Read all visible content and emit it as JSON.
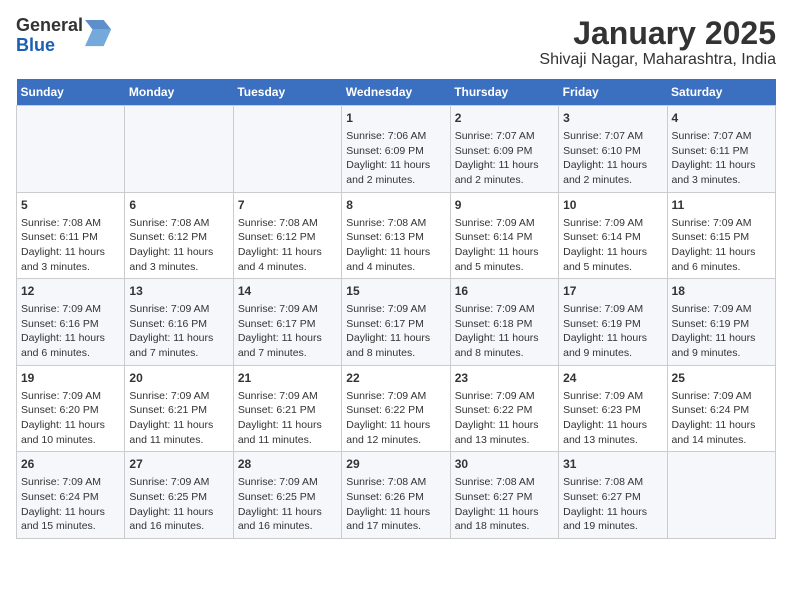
{
  "header": {
    "logo_line1": "General",
    "logo_line2": "Blue",
    "title": "January 2025",
    "subtitle": "Shivaji Nagar, Maharashtra, India"
  },
  "calendar": {
    "days_of_week": [
      "Sunday",
      "Monday",
      "Tuesday",
      "Wednesday",
      "Thursday",
      "Friday",
      "Saturday"
    ],
    "weeks": [
      [
        {
          "day": "",
          "info": ""
        },
        {
          "day": "",
          "info": ""
        },
        {
          "day": "",
          "info": ""
        },
        {
          "day": "1",
          "info": "Sunrise: 7:06 AM\nSunset: 6:09 PM\nDaylight: 11 hours and 2 minutes."
        },
        {
          "day": "2",
          "info": "Sunrise: 7:07 AM\nSunset: 6:09 PM\nDaylight: 11 hours and 2 minutes."
        },
        {
          "day": "3",
          "info": "Sunrise: 7:07 AM\nSunset: 6:10 PM\nDaylight: 11 hours and 2 minutes."
        },
        {
          "day": "4",
          "info": "Sunrise: 7:07 AM\nSunset: 6:11 PM\nDaylight: 11 hours and 3 minutes."
        }
      ],
      [
        {
          "day": "5",
          "info": "Sunrise: 7:08 AM\nSunset: 6:11 PM\nDaylight: 11 hours and 3 minutes."
        },
        {
          "day": "6",
          "info": "Sunrise: 7:08 AM\nSunset: 6:12 PM\nDaylight: 11 hours and 3 minutes."
        },
        {
          "day": "7",
          "info": "Sunrise: 7:08 AM\nSunset: 6:12 PM\nDaylight: 11 hours and 4 minutes."
        },
        {
          "day": "8",
          "info": "Sunrise: 7:08 AM\nSunset: 6:13 PM\nDaylight: 11 hours and 4 minutes."
        },
        {
          "day": "9",
          "info": "Sunrise: 7:09 AM\nSunset: 6:14 PM\nDaylight: 11 hours and 5 minutes."
        },
        {
          "day": "10",
          "info": "Sunrise: 7:09 AM\nSunset: 6:14 PM\nDaylight: 11 hours and 5 minutes."
        },
        {
          "day": "11",
          "info": "Sunrise: 7:09 AM\nSunset: 6:15 PM\nDaylight: 11 hours and 6 minutes."
        }
      ],
      [
        {
          "day": "12",
          "info": "Sunrise: 7:09 AM\nSunset: 6:16 PM\nDaylight: 11 hours and 6 minutes."
        },
        {
          "day": "13",
          "info": "Sunrise: 7:09 AM\nSunset: 6:16 PM\nDaylight: 11 hours and 7 minutes."
        },
        {
          "day": "14",
          "info": "Sunrise: 7:09 AM\nSunset: 6:17 PM\nDaylight: 11 hours and 7 minutes."
        },
        {
          "day": "15",
          "info": "Sunrise: 7:09 AM\nSunset: 6:17 PM\nDaylight: 11 hours and 8 minutes."
        },
        {
          "day": "16",
          "info": "Sunrise: 7:09 AM\nSunset: 6:18 PM\nDaylight: 11 hours and 8 minutes."
        },
        {
          "day": "17",
          "info": "Sunrise: 7:09 AM\nSunset: 6:19 PM\nDaylight: 11 hours and 9 minutes."
        },
        {
          "day": "18",
          "info": "Sunrise: 7:09 AM\nSunset: 6:19 PM\nDaylight: 11 hours and 9 minutes."
        }
      ],
      [
        {
          "day": "19",
          "info": "Sunrise: 7:09 AM\nSunset: 6:20 PM\nDaylight: 11 hours and 10 minutes."
        },
        {
          "day": "20",
          "info": "Sunrise: 7:09 AM\nSunset: 6:21 PM\nDaylight: 11 hours and 11 minutes."
        },
        {
          "day": "21",
          "info": "Sunrise: 7:09 AM\nSunset: 6:21 PM\nDaylight: 11 hours and 11 minutes."
        },
        {
          "day": "22",
          "info": "Sunrise: 7:09 AM\nSunset: 6:22 PM\nDaylight: 11 hours and 12 minutes."
        },
        {
          "day": "23",
          "info": "Sunrise: 7:09 AM\nSunset: 6:22 PM\nDaylight: 11 hours and 13 minutes."
        },
        {
          "day": "24",
          "info": "Sunrise: 7:09 AM\nSunset: 6:23 PM\nDaylight: 11 hours and 13 minutes."
        },
        {
          "day": "25",
          "info": "Sunrise: 7:09 AM\nSunset: 6:24 PM\nDaylight: 11 hours and 14 minutes."
        }
      ],
      [
        {
          "day": "26",
          "info": "Sunrise: 7:09 AM\nSunset: 6:24 PM\nDaylight: 11 hours and 15 minutes."
        },
        {
          "day": "27",
          "info": "Sunrise: 7:09 AM\nSunset: 6:25 PM\nDaylight: 11 hours and 16 minutes."
        },
        {
          "day": "28",
          "info": "Sunrise: 7:09 AM\nSunset: 6:25 PM\nDaylight: 11 hours and 16 minutes."
        },
        {
          "day": "29",
          "info": "Sunrise: 7:08 AM\nSunset: 6:26 PM\nDaylight: 11 hours and 17 minutes."
        },
        {
          "day": "30",
          "info": "Sunrise: 7:08 AM\nSunset: 6:27 PM\nDaylight: 11 hours and 18 minutes."
        },
        {
          "day": "31",
          "info": "Sunrise: 7:08 AM\nSunset: 6:27 PM\nDaylight: 11 hours and 19 minutes."
        },
        {
          "day": "",
          "info": ""
        }
      ]
    ]
  }
}
